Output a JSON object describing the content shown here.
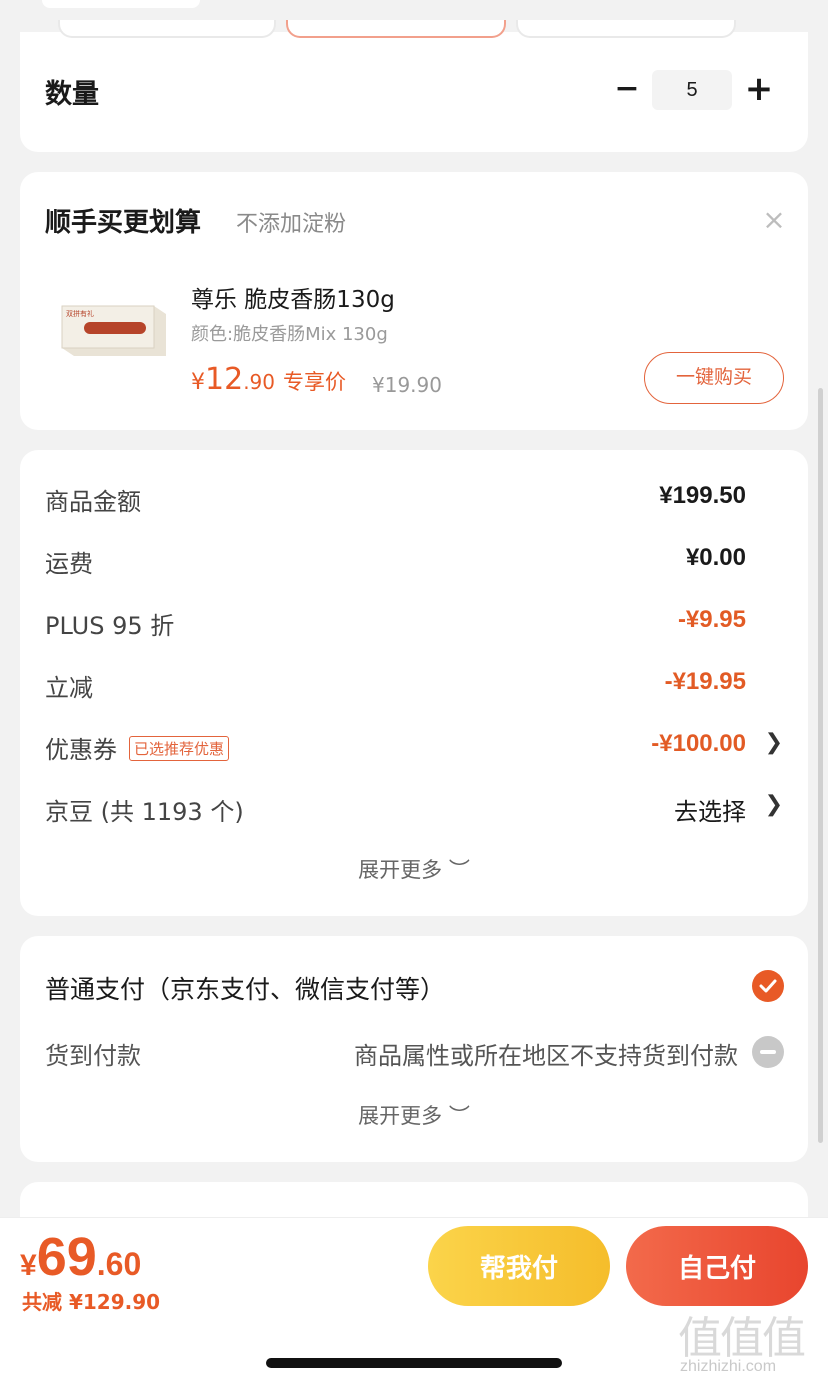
{
  "quantity": {
    "label": "数量",
    "minus": "−",
    "value": "5",
    "plus": "+"
  },
  "bundle": {
    "title": "顺手买更划算",
    "subtitle": "不添加淀粉",
    "close": "×",
    "product": {
      "image_text": "双拼有礼",
      "name": "尊乐 脆皮香肠130g",
      "spec": "颜色:脆皮香肠Mix 130g",
      "price_symbol": "¥",
      "price_int": "12",
      "price_dec": ".90",
      "price_tag": "专享价",
      "original_price": "¥19.90",
      "buy_button": "一键购买"
    }
  },
  "summary": {
    "rows": [
      {
        "label": "商品金额",
        "value": "¥199.50"
      },
      {
        "label": "运费",
        "value": "¥0.00"
      },
      {
        "label": "PLUS 95 折",
        "value": "-¥9.95"
      },
      {
        "label": "立减",
        "value": "-¥19.95"
      },
      {
        "label": "优惠券",
        "badge": "已选推荐优惠",
        "value": "-¥100.00"
      },
      {
        "label": "京豆 (共 1193 个)",
        "value": "去选择"
      }
    ],
    "expand": "展开更多 ︶"
  },
  "payment": {
    "main_option": "普通支付（京东支付、微信支付等）",
    "cod_label": "货到付款",
    "cod_note": "商品属性或所在地区不支持货到付款",
    "expand": "展开更多 ︶"
  },
  "footer": {
    "total_symbol": "¥",
    "total_int": "69",
    "total_dec": ".60",
    "saved": "共减 ¥129.90",
    "help_pay": "帮我付",
    "self_pay": "自己付"
  },
  "watermark": {
    "logo": "值值值",
    "url": "zhizhizhi.com"
  },
  "colors": {
    "accent": "#e85a26",
    "help_button": "#f5bd2b",
    "self_button": "#e8452e"
  }
}
